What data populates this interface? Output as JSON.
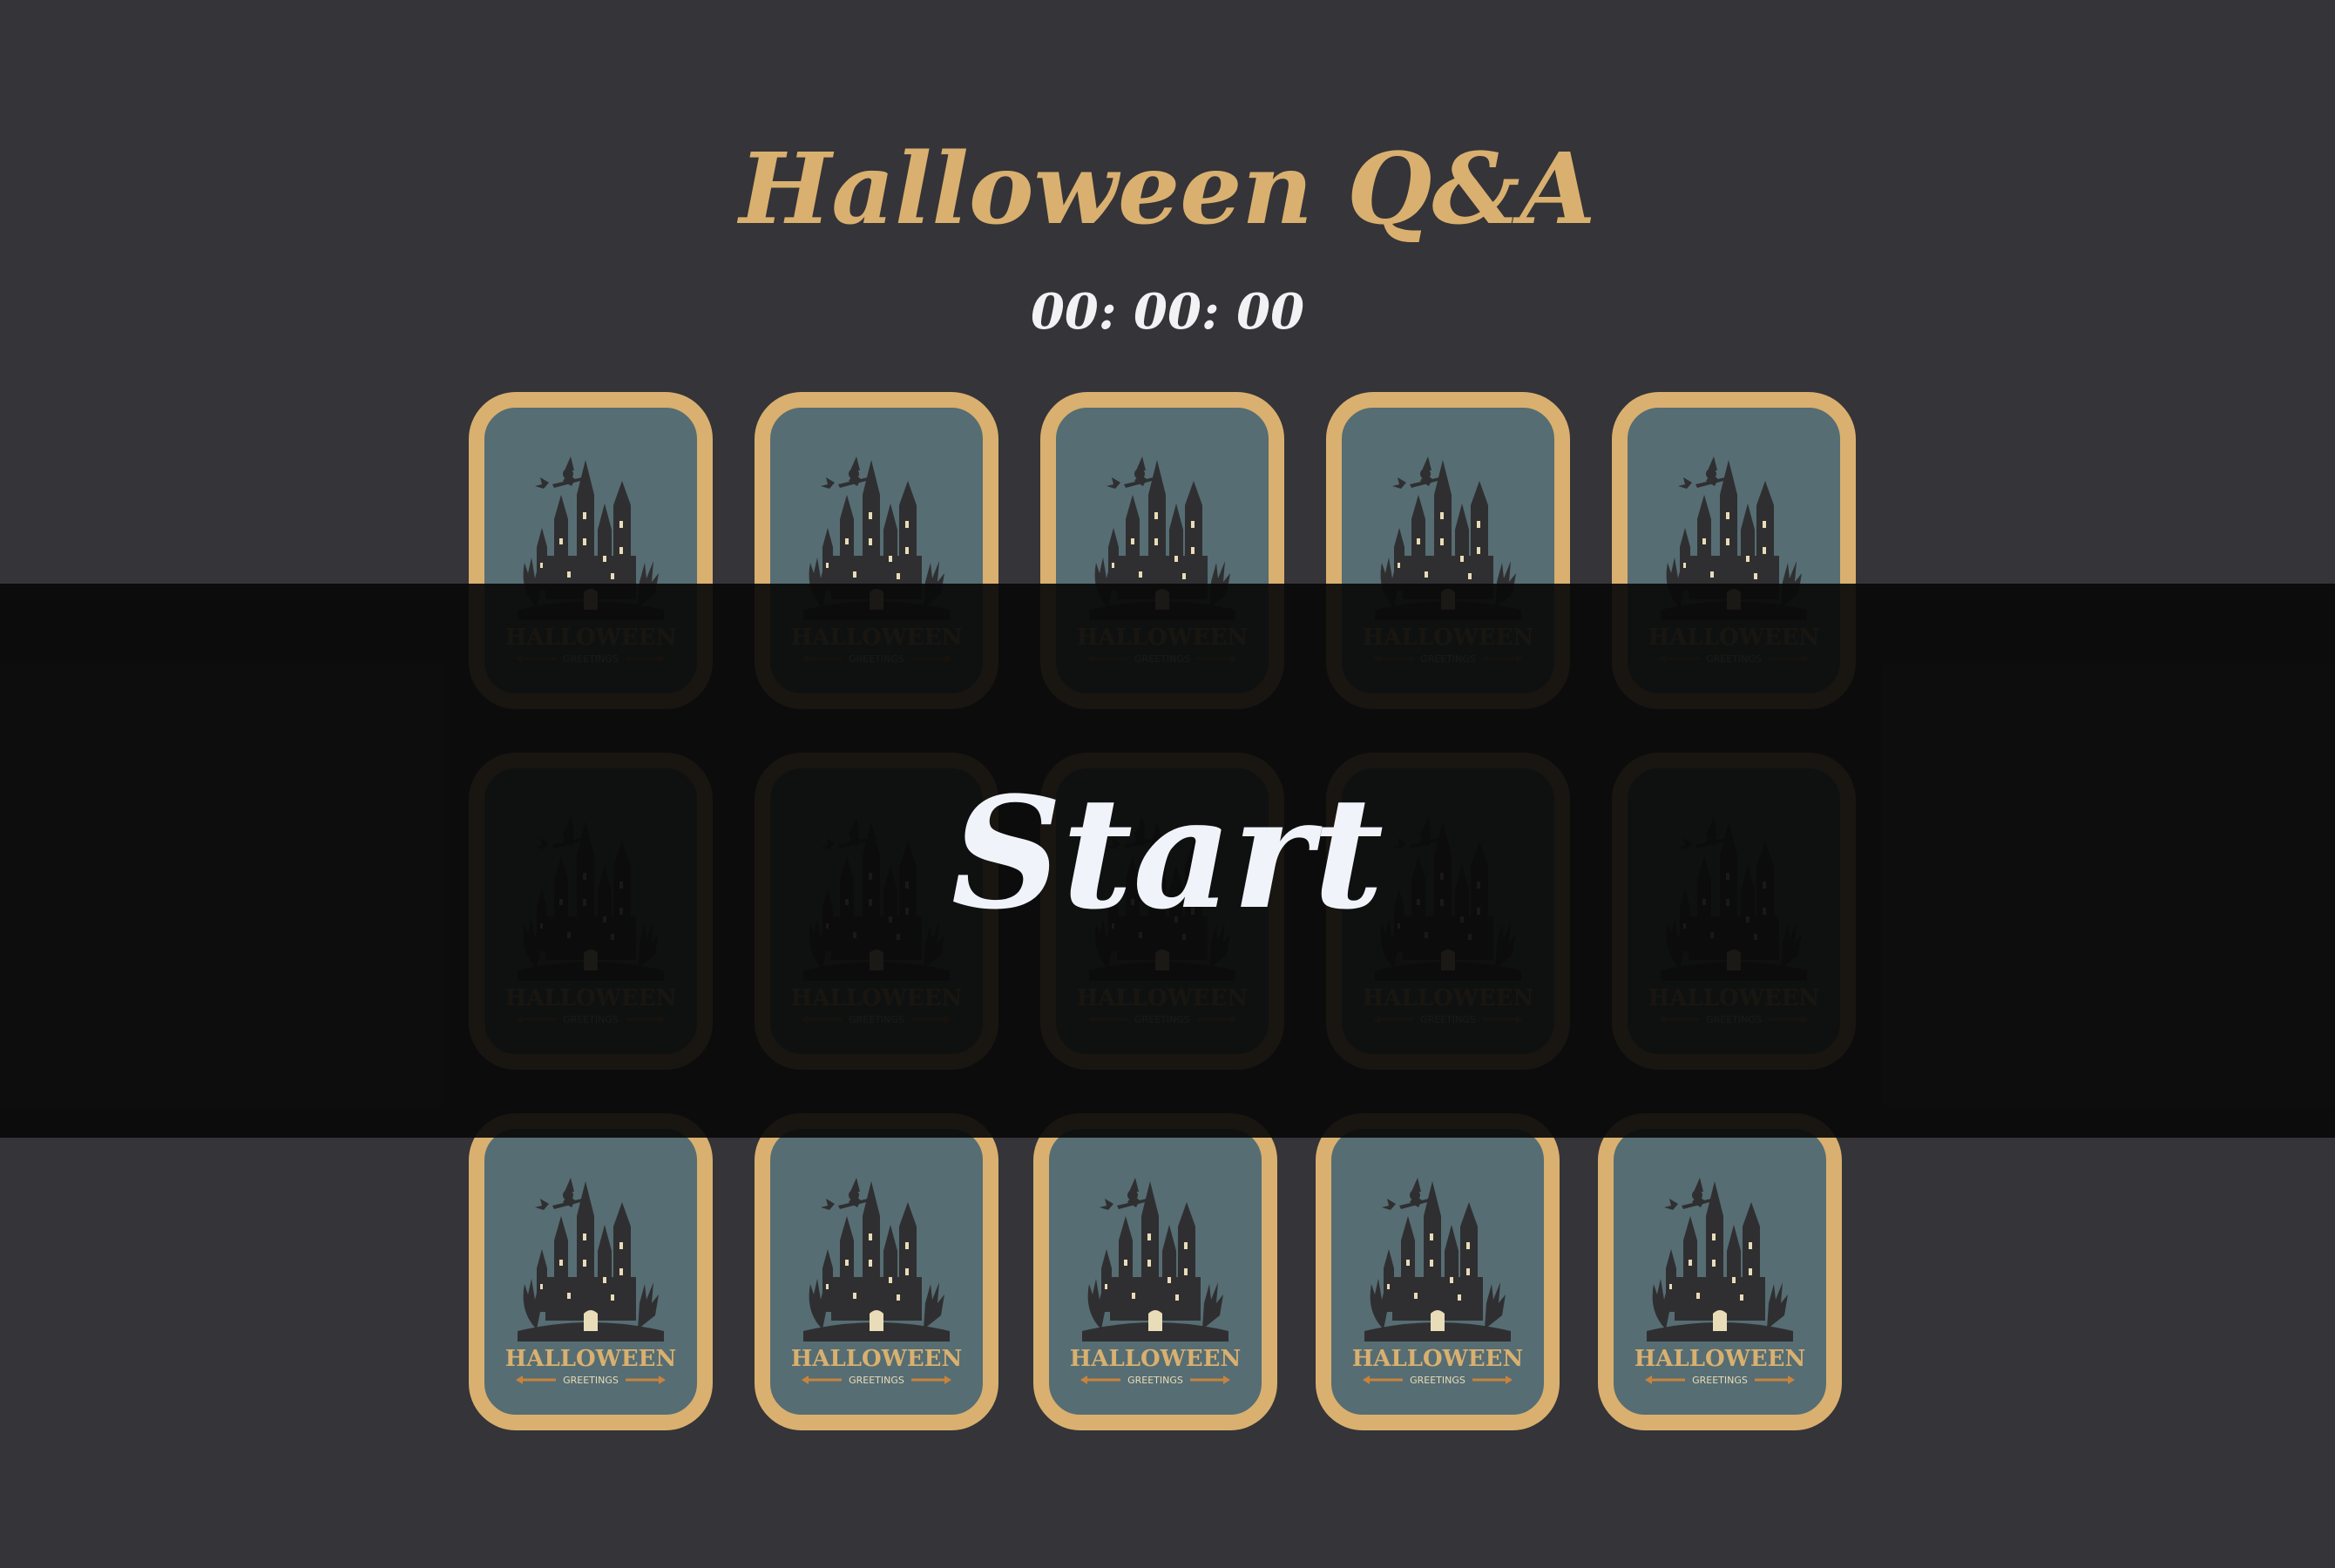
{
  "header": {
    "title": "Halloween Q&A",
    "timer": "00: 00: 00"
  },
  "overlay": {
    "start_label": "Start"
  },
  "card_back": {
    "label": "HALLOWEEN",
    "sublabel": "GREETINGS",
    "border_color": "#d9b06f",
    "face_color": "#566d73",
    "castle_color": "#2f2f31",
    "window_color": "#e9dcb8",
    "accent_color": "#c9833c"
  },
  "grid": {
    "rows": 3,
    "cols": 5,
    "cards": [
      {
        "id": "card-1"
      },
      {
        "id": "card-2"
      },
      {
        "id": "card-3"
      },
      {
        "id": "card-4"
      },
      {
        "id": "card-5"
      },
      {
        "id": "card-6"
      },
      {
        "id": "card-7"
      },
      {
        "id": "card-8"
      },
      {
        "id": "card-9"
      },
      {
        "id": "card-10"
      },
      {
        "id": "card-11"
      },
      {
        "id": "card-12"
      },
      {
        "id": "card-13"
      },
      {
        "id": "card-14"
      },
      {
        "id": "card-15"
      }
    ]
  },
  "colors": {
    "background": "#353438",
    "accent": "#d9b06f",
    "overlay": "#0a0a0a",
    "text_light": "#f0f4fa"
  }
}
